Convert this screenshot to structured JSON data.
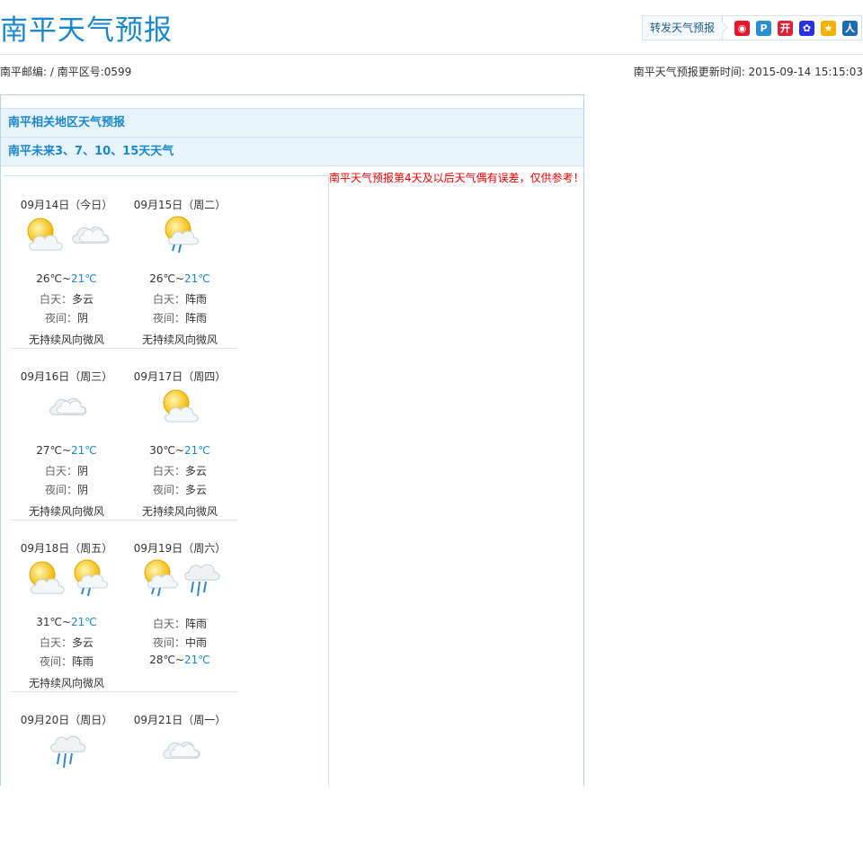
{
  "page_title": "南平天气预报",
  "share": {
    "label": "转发天气预报",
    "icons": [
      {
        "name": "weibo-icon",
        "color": "#e6162d",
        "glyph": "◉"
      },
      {
        "name": "qzone-icon",
        "color": "#2a8ed0",
        "glyph": "P"
      },
      {
        "name": "kaixin-icon",
        "color": "#d9243c",
        "glyph": "开"
      },
      {
        "name": "baidu-icon",
        "color": "#2932e1",
        "glyph": "✿"
      },
      {
        "name": "qq-space-icon",
        "color": "#f2b200",
        "glyph": "★"
      },
      {
        "name": "renren-icon",
        "color": "#1d6bb5",
        "glyph": "人"
      }
    ]
  },
  "meta": {
    "codes": "南平邮编: / 南平区号:0599",
    "update": "南平天气预报更新时间: 2015-09-14 15:15:03"
  },
  "panel": {
    "bar1": "南平相关地区天气预报",
    "bar2": "南平未来3、7、10、15天天气",
    "note": "南平天气预报第4天及以后天气偶有误差，仅供参考！"
  },
  "days": [
    {
      "date": "09月14日（今日）",
      "icons": [
        "sun-cloud-icon",
        "cloud-icon"
      ],
      "lines": [
        {
          "type": "temp",
          "high": "26℃~",
          "low": "21℃"
        },
        {
          "type": "kv",
          "k": "白天：",
          "v": "多云"
        },
        {
          "type": "kv",
          "k": "夜间：",
          "v": "阴"
        },
        {
          "type": "text",
          "v": "无持续风向微风"
        }
      ]
    },
    {
      "date": "09月15日（周二）",
      "icons": [
        "sun-shower-icon"
      ],
      "lines": [
        {
          "type": "temp",
          "high": "26℃~",
          "low": "21℃"
        },
        {
          "type": "kv",
          "k": "白天：",
          "v": "阵雨"
        },
        {
          "type": "kv",
          "k": "夜间：",
          "v": "阵雨"
        },
        {
          "type": "text",
          "v": "无持续风向微风"
        }
      ]
    },
    {
      "date": "09月16日（周三）",
      "icons": [
        "cloud-icon"
      ],
      "lines": [
        {
          "type": "temp",
          "high": "27℃~",
          "low": "21℃"
        },
        {
          "type": "kv",
          "k": "白天：",
          "v": "阴"
        },
        {
          "type": "kv",
          "k": "夜间：",
          "v": "阴"
        },
        {
          "type": "text",
          "v": "无持续风向微风"
        }
      ]
    },
    {
      "date": "09月17日（周四）",
      "icons": [
        "sun-cloud-icon"
      ],
      "lines": [
        {
          "type": "temp",
          "high": "30℃~",
          "low": "21℃"
        },
        {
          "type": "kv",
          "k": "白天：",
          "v": "多云"
        },
        {
          "type": "kv",
          "k": "夜间：",
          "v": "多云"
        },
        {
          "type": "text",
          "v": "无持续风向微风"
        }
      ]
    },
    {
      "date": "09月18日（周五）",
      "icons": [
        "sun-cloud-icon",
        "sun-shower-icon"
      ],
      "lines": [
        {
          "type": "temp",
          "high": "31℃~",
          "low": "21℃"
        },
        {
          "type": "kv",
          "k": "白天：",
          "v": "多云"
        },
        {
          "type": "kv",
          "k": "夜间：",
          "v": "阵雨"
        },
        {
          "type": "text",
          "v": "无持续风向微风"
        }
      ]
    },
    {
      "date": "09月19日（周六）",
      "icons": [
        "sun-shower-icon",
        "rain-icon"
      ],
      "lines": [
        {
          "type": "kv",
          "k": "白天：",
          "v": "阵雨"
        },
        {
          "type": "kv",
          "k": "夜间：",
          "v": "中雨"
        },
        {
          "type": "temp",
          "high": "28℃~",
          "low": "21℃"
        }
      ]
    },
    {
      "date": "09月20日（周日）",
      "icons": [
        "rain-icon"
      ],
      "lines": []
    },
    {
      "date": "09月21日（周一）",
      "icons": [
        "cloud-icon"
      ],
      "lines": []
    }
  ]
}
